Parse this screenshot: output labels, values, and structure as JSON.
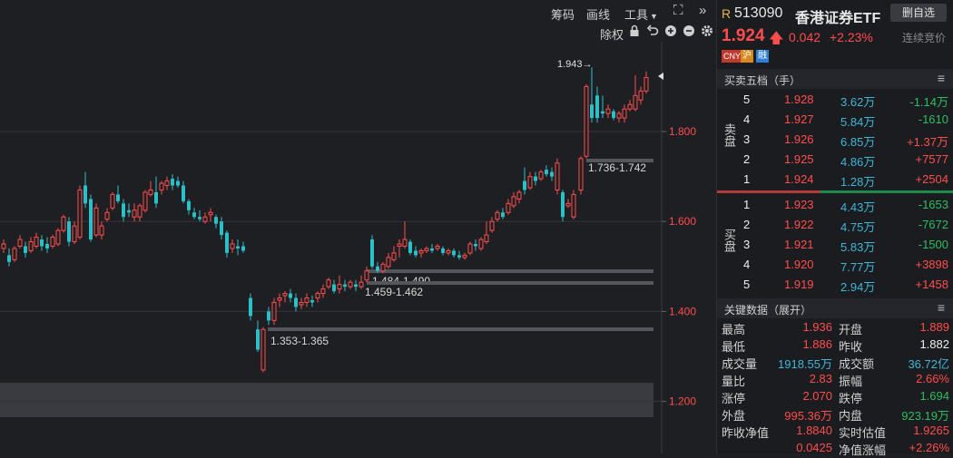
{
  "toolbar": {
    "chouma": "筹码",
    "huaxian": "画线",
    "gongju": "工具",
    "chuquan": "除权"
  },
  "chart": {
    "y_ticks": [
      "1.800",
      "1.600",
      "1.400",
      "1.200"
    ],
    "annotations": {
      "high": "1.943→",
      "zone1": "1.736-1.742",
      "zone2": "1.484-1.490",
      "zone3": "1.459-1.462",
      "zone4": "1.353-1.365"
    },
    "colors": {
      "up": "#ff4d4d",
      "down": "#2bc0c8"
    }
  },
  "quote": {
    "flag": "R",
    "code": "513090",
    "name": "香港证券ETF",
    "remove_button": "删自选",
    "price": "1.924",
    "change": "0.042",
    "change_pct": "+2.23%",
    "status": "连续竞价",
    "tags": [
      "CNY",
      "沪",
      "融"
    ]
  },
  "orderbook": {
    "title": "买卖五档（手）",
    "sell_label": "卖盘",
    "buy_label": "买盘",
    "sells": [
      {
        "level": "5",
        "price": "1.928",
        "vol": "3.62万",
        "diff": "-1.14万",
        "diff_color": "green"
      },
      {
        "level": "4",
        "price": "1.927",
        "vol": "5.84万",
        "diff": "-1610",
        "diff_color": "green"
      },
      {
        "level": "3",
        "price": "1.926",
        "vol": "6.85万",
        "diff": "+1.37万",
        "diff_color": "red"
      },
      {
        "level": "2",
        "price": "1.925",
        "vol": "4.86万",
        "diff": "+7577",
        "diff_color": "red"
      },
      {
        "level": "1",
        "price": "1.924",
        "vol": "1.28万",
        "diff": "+2504",
        "diff_color": "red"
      }
    ],
    "buys": [
      {
        "level": "1",
        "price": "1.923",
        "vol": "4.43万",
        "diff": "-1653",
        "diff_color": "green"
      },
      {
        "level": "2",
        "price": "1.922",
        "vol": "4.75万",
        "diff": "-7672",
        "diff_color": "green"
      },
      {
        "level": "3",
        "price": "1.921",
        "vol": "5.83万",
        "diff": "-1500",
        "diff_color": "green"
      },
      {
        "level": "4",
        "price": "1.920",
        "vol": "7.77万",
        "diff": "+3898",
        "diff_color": "red"
      },
      {
        "level": "5",
        "price": "1.919",
        "vol": "2.94万",
        "diff": "+1458",
        "diff_color": "red"
      }
    ]
  },
  "keydata": {
    "title": "关键数据（展开）",
    "rows": [
      [
        {
          "k": "最高",
          "v": "1.936",
          "c": "red"
        },
        {
          "k": "开盘",
          "v": "1.889",
          "c": "red"
        }
      ],
      [
        {
          "k": "最低",
          "v": "1.886",
          "c": "red"
        },
        {
          "k": "昨收",
          "v": "1.882",
          "c": "white"
        }
      ],
      [
        {
          "k": "成交量",
          "v": "1918.55万",
          "c": "cyan"
        },
        {
          "k": "成交额",
          "v": "36.72亿",
          "c": "cyan"
        }
      ],
      [
        {
          "k": "量比",
          "v": "2.83",
          "c": "red"
        },
        {
          "k": "振幅",
          "v": "2.66%",
          "c": "red"
        }
      ],
      [
        {
          "k": "涨停",
          "v": "2.070",
          "c": "red"
        },
        {
          "k": "跌停",
          "v": "1.694",
          "c": "green"
        }
      ],
      [
        {
          "k": "外盘",
          "v": "995.36万",
          "c": "red"
        },
        {
          "k": "内盘",
          "v": "923.19万",
          "c": "green"
        }
      ],
      [
        {
          "k": "昨收净值",
          "v": "1.8840",
          "c": "red"
        },
        {
          "k": "实时估值",
          "v": "1.9265",
          "c": "red"
        }
      ],
      [
        {
          "k": "",
          "v": "0.0425",
          "c": "red"
        },
        {
          "k": "净值涨幅",
          "v": "+2.26%",
          "c": "red"
        }
      ]
    ]
  }
}
